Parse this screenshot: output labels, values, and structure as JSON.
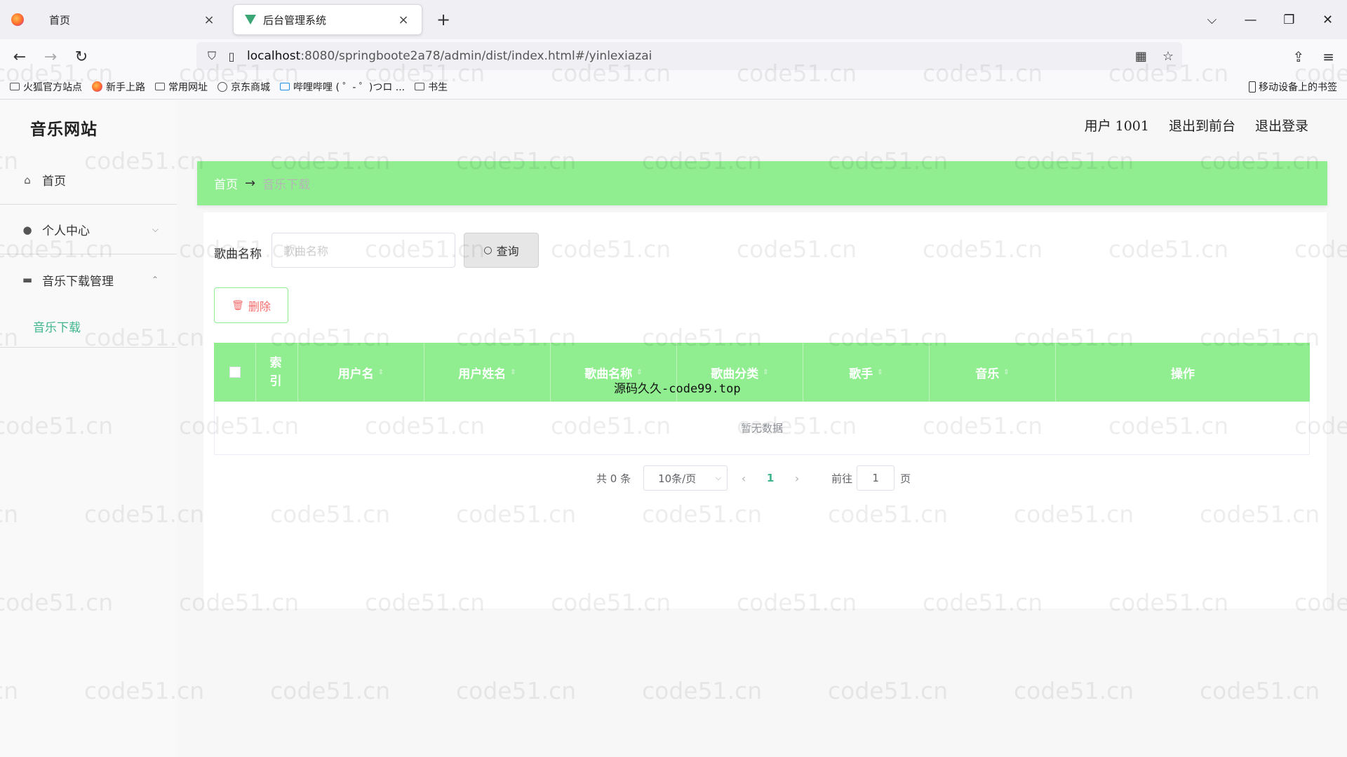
{
  "browser": {
    "tabs": [
      {
        "title": "首页",
        "close": "×"
      },
      {
        "title": "后台管理系统",
        "close": "×"
      }
    ],
    "new_tab": "+",
    "window_controls": {
      "list": "⌵",
      "minimize": "—",
      "restore": "❐",
      "close": "✕"
    },
    "url": {
      "host": "localhost",
      "rest": ":8080/springbootе2a78/admin/dist/index.html#/yinlexiazai"
    },
    "bookmarks": [
      "火狐官方站点",
      "新手上路",
      "常用网址",
      "京东商城",
      "哔哩哔哩 ( ゜- ゜)つロ ...",
      "书生"
    ],
    "mobile_bookmarks": "移动设备上的书签"
  },
  "app": {
    "brand": "音乐网站",
    "header": {
      "user": "用户 1001",
      "to_front": "退出到前台",
      "logout": "退出登录"
    },
    "sidebar": {
      "home": "首页",
      "personal_center": "个人中心",
      "music_download_mgmt": "音乐下载管理",
      "music_download": "音乐下载"
    },
    "breadcrumb": {
      "home": "首页",
      "arrow": "→",
      "current": "音乐下载"
    },
    "search": {
      "label": "歌曲名称",
      "placeholder": "歌曲名称",
      "button": "查询"
    },
    "delete_button": "删除",
    "table": {
      "headers": [
        "索引",
        "用户名",
        "用户姓名",
        "歌曲名称",
        "歌曲分类",
        "歌手",
        "音乐",
        "操作"
      ],
      "empty_text": "暂无数据"
    },
    "pagination": {
      "total": "共 0 条",
      "page_size": "10条/页",
      "current_page": "1",
      "goto_prefix": "前往",
      "goto_value": "1",
      "goto_suffix": "页"
    },
    "overlay_text": "源码久久-code99.top",
    "watermark": "code51.cn"
  }
}
